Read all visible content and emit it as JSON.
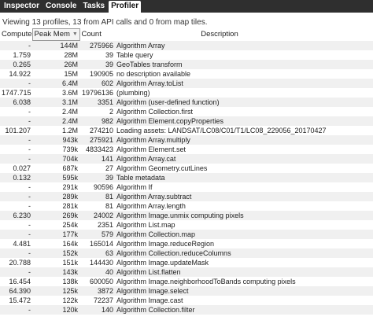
{
  "tabs": [
    {
      "label": "Inspector",
      "active": false
    },
    {
      "label": "Console",
      "active": false
    },
    {
      "label": "Tasks",
      "active": false
    },
    {
      "label": "Profiler",
      "active": true
    }
  ],
  "summary": "Viewing 13 profiles, 13 from API calls and 0 from map tiles.",
  "columns": {
    "compute": "Compute",
    "peak_mem": "Peak Mem",
    "count": "Count",
    "description": "Description",
    "sort_icon": "▼"
  },
  "rows": [
    {
      "compute": "-",
      "mem": "144M",
      "count": "275966",
      "desc": "Algorithm Array"
    },
    {
      "compute": "1.759",
      "mem": "28M",
      "count": "39",
      "desc": "Table query"
    },
    {
      "compute": "0.265",
      "mem": "26M",
      "count": "39",
      "desc": "GeoTables transform"
    },
    {
      "compute": "14.922",
      "mem": "15M",
      "count": "190905",
      "desc": "no description available"
    },
    {
      "compute": "-",
      "mem": "6.4M",
      "count": "602",
      "desc": "Algorithm Array.toList"
    },
    {
      "compute": "1747.715",
      "mem": "3.6M",
      "count": "19796136",
      "desc": "(plumbing)"
    },
    {
      "compute": "6.038",
      "mem": "3.1M",
      "count": "3351",
      "desc": "Algorithm (user-defined function)"
    },
    {
      "compute": "-",
      "mem": "2.4M",
      "count": "2",
      "desc": "Algorithm Collection.first"
    },
    {
      "compute": "-",
      "mem": "2.4M",
      "count": "982",
      "desc": "Algorithm Element.copyProperties"
    },
    {
      "compute": "101.207",
      "mem": "1.2M",
      "count": "274210",
      "desc": "Loading assets: LANDSAT/LC08/C01/T1/LC08_229056_20170427"
    },
    {
      "compute": "-",
      "mem": "943k",
      "count": "275921",
      "desc": "Algorithm Array.multiply"
    },
    {
      "compute": "-",
      "mem": "739k",
      "count": "4833423",
      "desc": "Algorithm Element.set"
    },
    {
      "compute": "-",
      "mem": "704k",
      "count": "141",
      "desc": "Algorithm Array.cat"
    },
    {
      "compute": "0.027",
      "mem": "687k",
      "count": "27",
      "desc": "Algorithm Geometry.cutLines"
    },
    {
      "compute": "0.132",
      "mem": "595k",
      "count": "39",
      "desc": "Table metadata"
    },
    {
      "compute": "-",
      "mem": "291k",
      "count": "90596",
      "desc": "Algorithm If"
    },
    {
      "compute": "-",
      "mem": "289k",
      "count": "81",
      "desc": "Algorithm Array.subtract"
    },
    {
      "compute": "-",
      "mem": "281k",
      "count": "81",
      "desc": "Algorithm Array.length"
    },
    {
      "compute": "6.230",
      "mem": "269k",
      "count": "24002",
      "desc": "Algorithm Image.unmix computing pixels"
    },
    {
      "compute": "-",
      "mem": "254k",
      "count": "2351",
      "desc": "Algorithm List.map"
    },
    {
      "compute": "-",
      "mem": "177k",
      "count": "579",
      "desc": "Algorithm Collection.map"
    },
    {
      "compute": "4.481",
      "mem": "164k",
      "count": "165014",
      "desc": "Algorithm Image.reduceRegion"
    },
    {
      "compute": "-",
      "mem": "152k",
      "count": "63",
      "desc": "Algorithm Collection.reduceColumns"
    },
    {
      "compute": "20.788",
      "mem": "151k",
      "count": "144430",
      "desc": "Algorithm Image.updateMask"
    },
    {
      "compute": "-",
      "mem": "143k",
      "count": "40",
      "desc": "Algorithm List.flatten"
    },
    {
      "compute": "16.454",
      "mem": "138k",
      "count": "600050",
      "desc": "Algorithm Image.neighborhoodToBands computing pixels"
    },
    {
      "compute": "64.390",
      "mem": "125k",
      "count": "3872",
      "desc": "Algorithm Image.select"
    },
    {
      "compute": "15.472",
      "mem": "122k",
      "count": "72237",
      "desc": "Algorithm Image.cast"
    },
    {
      "compute": "-",
      "mem": "120k",
      "count": "140",
      "desc": "Algorithm Collection.filter"
    }
  ]
}
